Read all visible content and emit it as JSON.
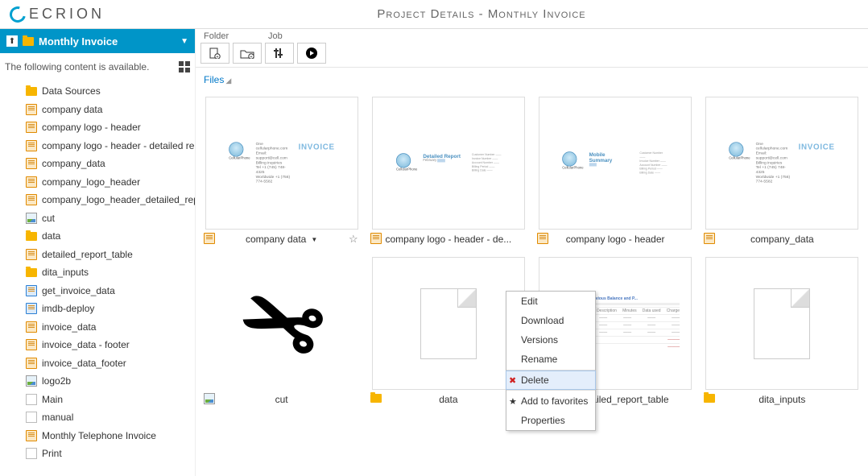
{
  "header": {
    "brand": "ECRION",
    "title": "Project Details - Monthly Invoice"
  },
  "sidebar": {
    "crumb": "Monthly Invoice",
    "available_text": "The following content is available.",
    "items": [
      {
        "label": "Data Sources",
        "icon": "folder"
      },
      {
        "label": "company data",
        "icon": "doc-orange"
      },
      {
        "label": "company logo - header",
        "icon": "doc-orange"
      },
      {
        "label": "company logo - header - detailed rep...",
        "icon": "doc-orange"
      },
      {
        "label": "company_data",
        "icon": "doc-orange"
      },
      {
        "label": "company_logo_header",
        "icon": "doc-orange"
      },
      {
        "label": "company_logo_header_detailed_report",
        "icon": "doc-orange"
      },
      {
        "label": "cut",
        "icon": "img"
      },
      {
        "label": "data",
        "icon": "folder"
      },
      {
        "label": "detailed_report_table",
        "icon": "doc-orange",
        "locked": true
      },
      {
        "label": "dita_inputs",
        "icon": "folder"
      },
      {
        "label": "get_invoice_data",
        "icon": "doc-blue"
      },
      {
        "label": "imdb-deploy",
        "icon": "doc-blue"
      },
      {
        "label": "invoice_data",
        "icon": "doc-orange"
      },
      {
        "label": "invoice_data - footer",
        "icon": "doc-orange"
      },
      {
        "label": "invoice_data_footer",
        "icon": "doc-orange"
      },
      {
        "label": "logo2b",
        "icon": "img"
      },
      {
        "label": "Main",
        "icon": "page"
      },
      {
        "label": "manual",
        "icon": "page"
      },
      {
        "label": "Monthly Telephone Invoice",
        "icon": "doc-orange"
      },
      {
        "label": "Print",
        "icon": "page"
      }
    ]
  },
  "toolbar": {
    "group_folder": "Folder",
    "group_job": "Job"
  },
  "breadcrumb": {
    "root": "Files"
  },
  "tiles": [
    {
      "label": "company data",
      "type": "invoice",
      "selected": true,
      "icon": "doc-orange"
    },
    {
      "label": "company logo - header - de...",
      "type": "detailed",
      "icon": "doc-orange"
    },
    {
      "label": "company logo - header",
      "type": "mobile",
      "icon": "doc-orange"
    },
    {
      "label": "company_data",
      "type": "invoice",
      "icon": "doc-orange"
    },
    {
      "label": "cut",
      "type": "scissors",
      "icon": "img"
    },
    {
      "label": "data",
      "type": "pagefold",
      "icon": "folder"
    },
    {
      "label": "detailed_report_table",
      "type": "table",
      "icon": "doc-orange",
      "locked": true
    },
    {
      "label": "dita_inputs",
      "type": "pagefold",
      "icon": "folder"
    }
  ],
  "preview_text": {
    "invoice_label": "INVOICE",
    "detailed_label": "Detailed Report",
    "mobile_label": "Mobile Summary"
  },
  "context_menu": {
    "items": [
      {
        "label": "Edit"
      },
      {
        "label": "Download"
      },
      {
        "label": "Versions"
      },
      {
        "label": "Rename",
        "sep": true
      },
      {
        "label": "Delete",
        "icon": "✖",
        "hl": true,
        "sep": true
      },
      {
        "label": "Add to favorites",
        "icon": "★"
      },
      {
        "label": "Properties"
      }
    ]
  }
}
